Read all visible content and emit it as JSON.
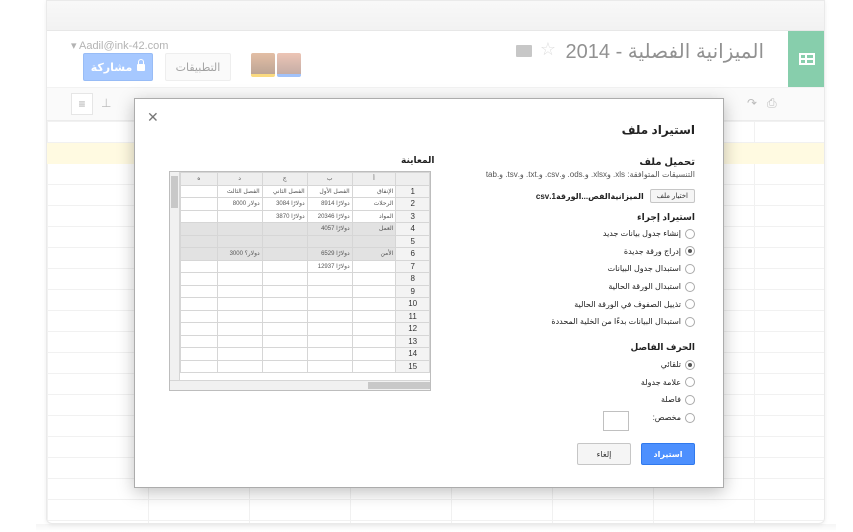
{
  "header": {
    "doc_title": "الميزانية الفصلية - 2014",
    "user_email": "Aadil@ink-42.com",
    "share_label": "مشاركة",
    "apps_label": "التطبيقات"
  },
  "dialog": {
    "title": "استيراد ملف",
    "upload_title": "تحميل ملف",
    "formats": "التنسيقات المتوافقة: xls. وxlsx. و.ods. و.csv. و.txt. و.tsv. و.tab",
    "choose_file_label": "اختيار ملف",
    "file_name": "الميزانيةالفص...الورقة1.csv",
    "import_action_title": "استيراد إجراء",
    "import_actions": [
      {
        "label": "إنشاء جدول بيانات جديد",
        "checked": false
      },
      {
        "label": "إدراج ورقة جديدة",
        "checked": true
      },
      {
        "label": "استبدال جدول البيانات",
        "checked": false
      },
      {
        "label": "استبدال الورقة الحالية",
        "checked": false
      },
      {
        "label": "تذييل الصفوف في الورقة الحالية",
        "checked": false
      },
      {
        "label": "استبدال البيانات بدءًا من الخلية المحددة",
        "checked": false
      }
    ],
    "separator_title": "الحرف الفاصل",
    "separators": [
      {
        "label": "تلقائي",
        "checked": true
      },
      {
        "label": "علامة جدولة",
        "checked": false
      },
      {
        "label": "فاصلة",
        "checked": false
      },
      {
        "label": "مخصص:",
        "checked": false
      }
    ],
    "import_button": "استيراد",
    "cancel_button": "إلغاء",
    "close_icon": "close-icon"
  },
  "preview": {
    "title": "المعاينة",
    "columns": [
      "أ",
      "ب",
      "ج",
      "د",
      "ه"
    ],
    "rows": [
      {
        "num": "1",
        "cells": [
          "الإنفاق",
          "الفصل الأول",
          "الفصل الثاني",
          "الفصل الثالث",
          ""
        ],
        "shaded": false
      },
      {
        "num": "2",
        "cells": [
          "الرحلات",
          "8914 دولارًا",
          "3084 دولارًا",
          "8000 دولار",
          ""
        ],
        "shaded": false
      },
      {
        "num": "3",
        "cells": [
          "المواد",
          "20346 دولارًا",
          "3870 دولارًا",
          "",
          ""
        ],
        "shaded": false
      },
      {
        "num": "4",
        "cells": [
          "العمل",
          "4057 دولارًا",
          "",
          "",
          ""
        ],
        "shaded": true
      },
      {
        "num": "5",
        "cells": [
          "",
          "",
          "",
          "",
          ""
        ],
        "shaded": true
      },
      {
        "num": "6",
        "cells": [
          "الأمن",
          "6529 دولارًا",
          "",
          "3000 دولار؟",
          ""
        ],
        "shaded": true
      },
      {
        "num": "7",
        "cells": [
          "",
          "12937 دولارًا",
          "",
          "",
          ""
        ],
        "shaded": false
      },
      {
        "num": "8",
        "cells": [
          "",
          "",
          "",
          "",
          ""
        ],
        "shaded": false
      },
      {
        "num": "9",
        "cells": [
          "",
          "",
          "",
          "",
          ""
        ],
        "shaded": false
      },
      {
        "num": "10",
        "cells": [
          "",
          "",
          "",
          "",
          ""
        ],
        "shaded": false
      },
      {
        "num": "11",
        "cells": [
          "",
          "",
          "",
          "",
          ""
        ],
        "shaded": false
      },
      {
        "num": "12",
        "cells": [
          "",
          "",
          "",
          "",
          ""
        ],
        "shaded": false
      },
      {
        "num": "13",
        "cells": [
          "",
          "",
          "",
          "",
          ""
        ],
        "shaded": false
      },
      {
        "num": "14",
        "cells": [
          "",
          "",
          "",
          "",
          ""
        ],
        "shaded": false
      },
      {
        "num": "15",
        "cells": [
          "",
          "",
          "",
          "",
          ""
        ],
        "shaded": false
      }
    ]
  },
  "colors": {
    "accent_blue": "#4d90fe",
    "sheets_green": "#0f9d58"
  }
}
